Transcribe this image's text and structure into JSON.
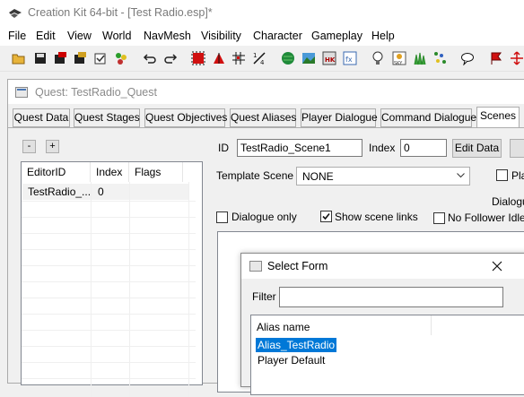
{
  "app": {
    "title": "Creation Kit 64-bit - [Test Radio.esp]*",
    "menu": [
      "File",
      "Edit",
      "View",
      "World",
      "NavMesh",
      "Visibility",
      "Character",
      "Gameplay",
      "Help"
    ]
  },
  "toolbar": {
    "icons": [
      "open-icon",
      "save-icon",
      "esp-icon",
      "esp-save-icon",
      "check-icon",
      "filter-icon",
      "undo-icon",
      "redo-icon",
      "render-window-icon",
      "triangle-icon",
      "grid-icon",
      "snap-icon",
      "globe-icon",
      "landscape-icon",
      "havok-icon",
      "fog-icon",
      "light-icon",
      "sky-icon",
      "grass-icon",
      "dots-icon",
      "speech-icon",
      "marker-icon",
      "arrows-icon"
    ]
  },
  "quest_window": {
    "title": "Quest: TestRadio_Quest",
    "tabs": [
      "Quest Data",
      "Quest Stages",
      "Quest Objectives",
      "Quest Aliases",
      "Player Dialogue",
      "Command Dialogue",
      "Scenes"
    ],
    "active_tab": "Scenes",
    "minus_label": "-",
    "plus_label": "+",
    "scene_list": {
      "columns": [
        "EditorID",
        "Index",
        "Flags"
      ],
      "rows": [
        {
          "editor_id": "TestRadio_...",
          "index": "0",
          "flags": ""
        }
      ]
    },
    "id_label": "ID",
    "id_value": "TestRadio_Scene1",
    "index_label": "Index",
    "index_value": "0",
    "edit_data_label": "Edit Data",
    "template_scene_label": "Template Scene",
    "template_scene_value": "NONE",
    "pla_label": "Pla",
    "dialogue_label": "Dialogu",
    "dialogue_only_label": "Dialogue only",
    "dialogue_only_checked": false,
    "show_scene_links_label": "Show scene links",
    "show_scene_links_checked": true,
    "no_follower_idle_label": "No Follower Idle C",
    "no_follower_idle_checked": false
  },
  "select_form": {
    "title": "Select Form",
    "filter_label": "Filter",
    "filter_value": "",
    "column": "Alias name",
    "items": [
      "Alias_TestRadio",
      "Player Default"
    ],
    "selected": "Alias_TestRadio",
    "selection_color": "#0078d7"
  }
}
